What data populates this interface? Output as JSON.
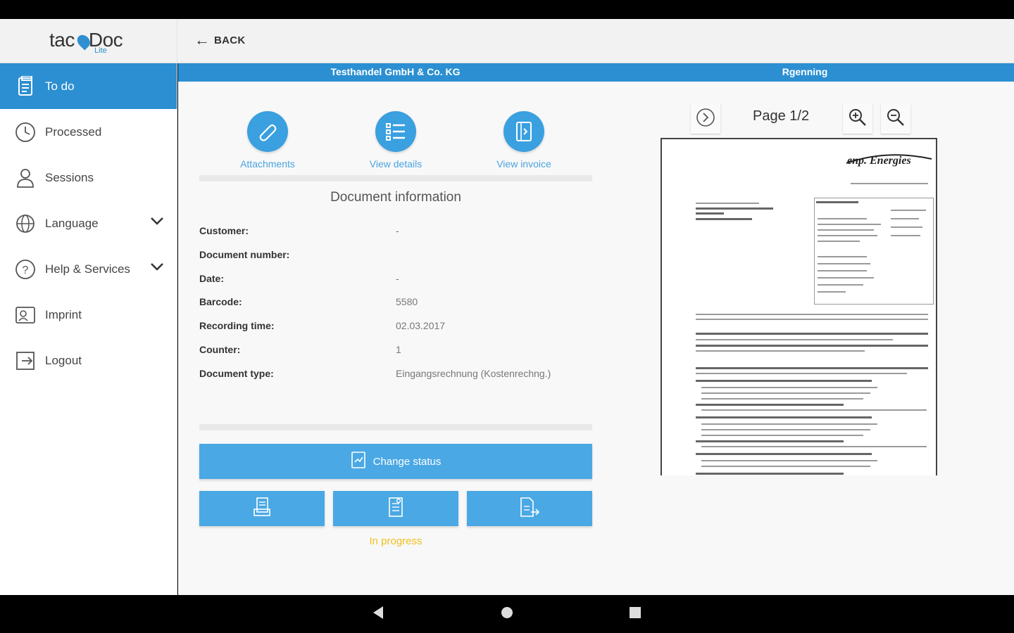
{
  "header": {
    "logo_text_left": "tac",
    "logo_text_right": "Doc",
    "logo_sub": "Lite",
    "back_label": "BACK"
  },
  "sidebar": {
    "items": [
      {
        "label": "To do",
        "icon": "todo-icon",
        "active": true
      },
      {
        "label": "Processed",
        "icon": "clock-icon"
      },
      {
        "label": "Sessions",
        "icon": "user-icon"
      },
      {
        "label": "Language",
        "icon": "globe-icon",
        "expandable": true
      },
      {
        "label": "Help & Services",
        "icon": "help-icon",
        "expandable": true
      },
      {
        "label": "Imprint",
        "icon": "imprint-icon"
      },
      {
        "label": "Logout",
        "icon": "logout-icon"
      }
    ]
  },
  "title_bar": {
    "company": "Testhandel GmbH & Co. KG",
    "doc_type": "Rgenning"
  },
  "actions": {
    "attachments": "Attachments",
    "view_details": "View details",
    "view_invoice": "View invoice"
  },
  "doc_info": {
    "title": "Document information",
    "rows": [
      {
        "key": "Customer:",
        "value": "-"
      },
      {
        "key": "Document number:",
        "value": ""
      },
      {
        "key": "Date:",
        "value": "-"
      },
      {
        "key": "Barcode:",
        "value": "5580"
      },
      {
        "key": "Recording time:",
        "value": "02.03.2017"
      },
      {
        "key": "Counter:",
        "value": "1"
      },
      {
        "key": "Document type:",
        "value": "Eingangsrechnung (Kostenrechng.)"
      }
    ]
  },
  "status": {
    "change_label": "Change status",
    "current": "In progress"
  },
  "viewer": {
    "page_label": "Page 1/2",
    "doc_logo": "enp. Energies"
  },
  "colors": {
    "accent": "#2b8fd2",
    "button": "#4aa8e4",
    "status_in_progress": "#f0c020"
  }
}
